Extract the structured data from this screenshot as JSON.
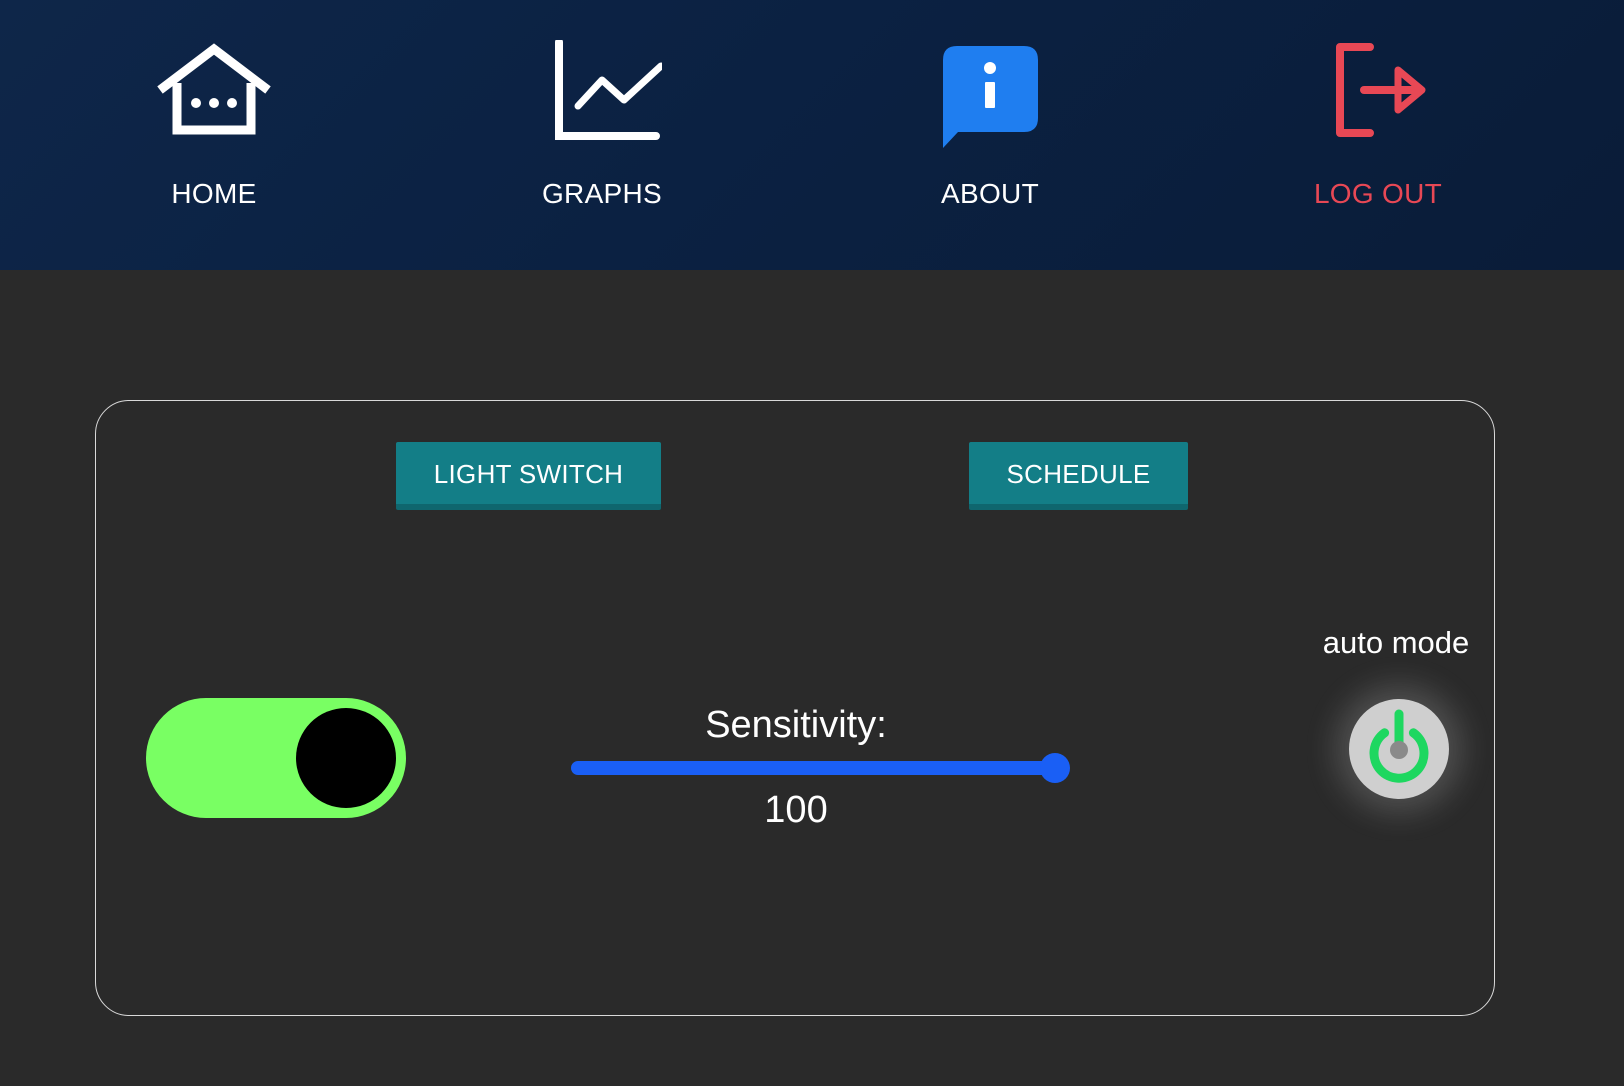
{
  "nav": {
    "items": [
      {
        "label": "HOME",
        "icon": "home-icon"
      },
      {
        "label": "GRAPHS",
        "icon": "line-chart-icon"
      },
      {
        "label": "ABOUT",
        "icon": "info-bubble-icon"
      },
      {
        "label": "LOG OUT",
        "icon": "logout-icon"
      }
    ]
  },
  "tabs": {
    "light_switch": "LIGHT SWITCH",
    "schedule": "SCHEDULE"
  },
  "light_toggle": {
    "state": "on"
  },
  "sensitivity": {
    "label": "Sensitivity:",
    "value": "100",
    "slider_fraction": 1.0
  },
  "auto_mode": {
    "label": "auto mode",
    "state": "on"
  },
  "colors": {
    "nav_background": "#0b2142",
    "page_background": "#2a2a2a",
    "tab_button": "#137e87",
    "about_icon": "#1f7ef0",
    "logout": "#e84855",
    "toggle_on": "#79ff63",
    "slider": "#1a5ff5",
    "power_on": "#1ed760",
    "panel_border": "#d9d9d9"
  }
}
